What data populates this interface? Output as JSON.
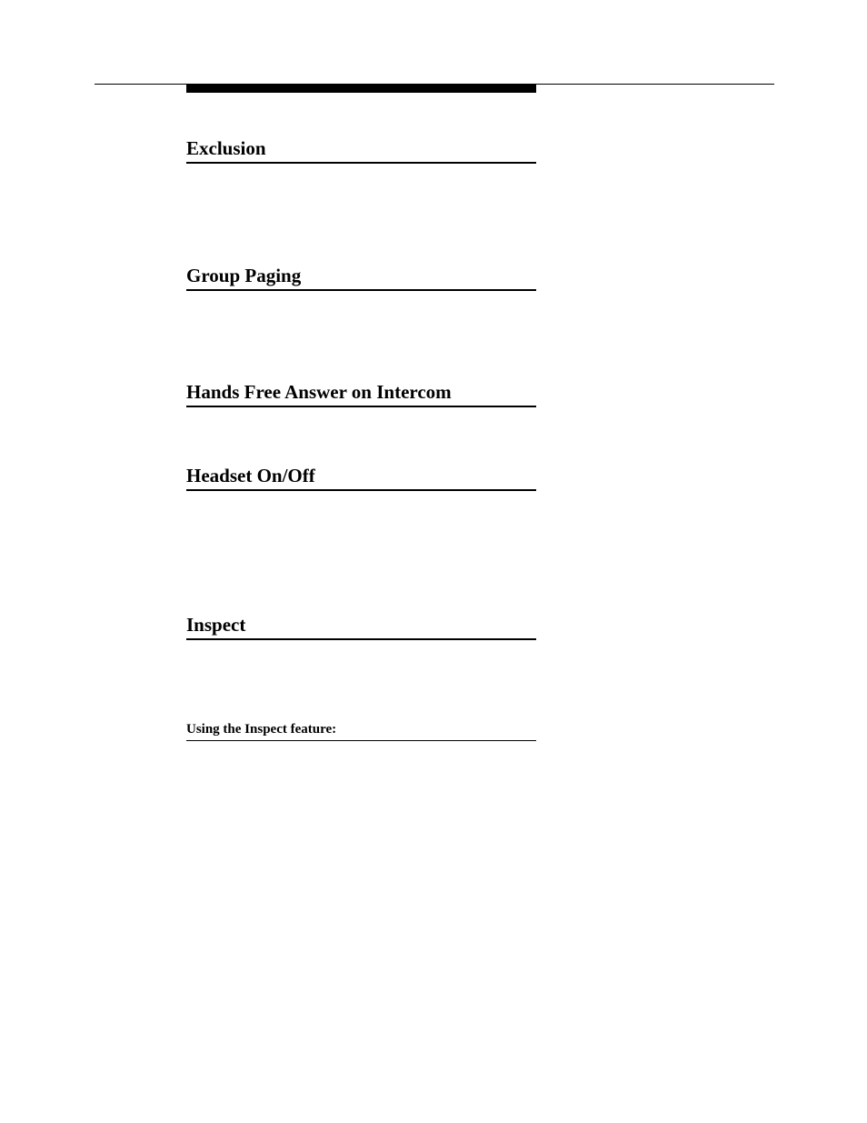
{
  "sections": {
    "s1": {
      "title": "Exclusion"
    },
    "s2": {
      "title": "Group Paging"
    },
    "s3": {
      "title": "Hands Free Answer on Intercom"
    },
    "s4": {
      "title": "Headset On/Off"
    },
    "s5": {
      "title": "Inspect"
    },
    "sub1": {
      "title": "Using the Inspect feature:"
    }
  }
}
